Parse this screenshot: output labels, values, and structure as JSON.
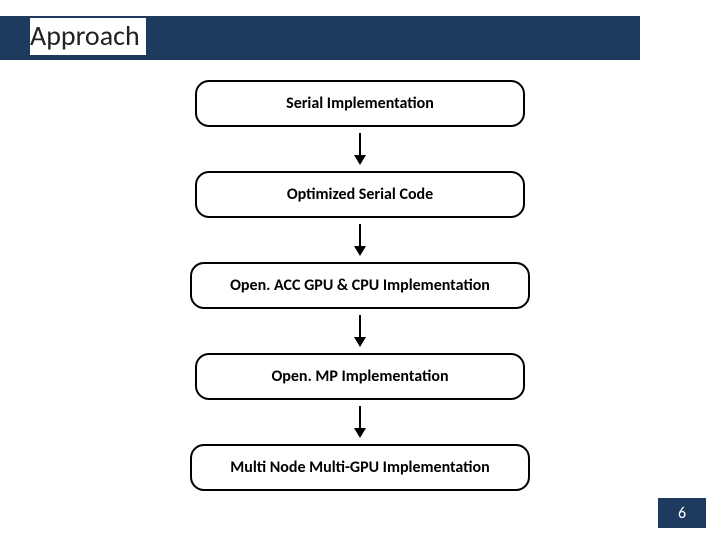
{
  "title": "Approach",
  "steps": [
    "Serial Implementation",
    "Optimized Serial Code",
    "Open. ACC GPU & CPU Implementation",
    "Open. MP Implementation",
    "Multi Node Multi-GPU Implementation"
  ],
  "page_number": "6"
}
